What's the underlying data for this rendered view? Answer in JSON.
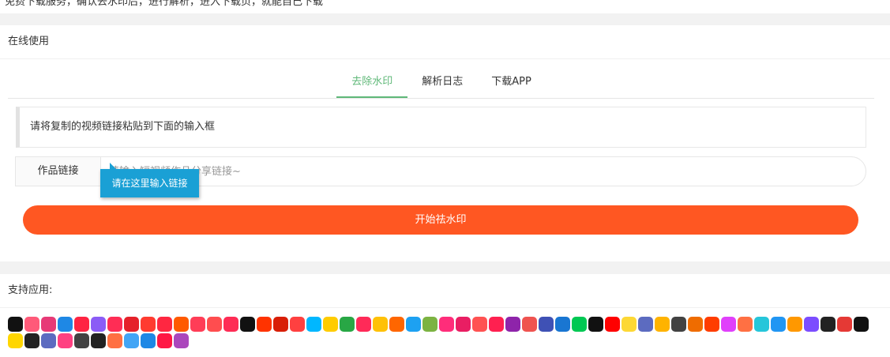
{
  "top_strip": {
    "text": "免费下载服务，确认去水印后，进行解析，进入下载页，就能自己下载"
  },
  "online": {
    "header": "在线使用",
    "tabs": [
      {
        "label": "去除水印",
        "active": true
      },
      {
        "label": "解析日志",
        "active": false
      },
      {
        "label": "下载APP",
        "active": false
      }
    ],
    "instruction": "请将复制的视频链接粘贴到下面的输入框",
    "link_label": "作品链接",
    "link_placeholder": "请输入短视频作品分享链接~",
    "link_value": "",
    "tooltip": "请在这里输入链接",
    "start_button": "开始祛水印"
  },
  "apps": {
    "header": "支持应用:",
    "icon_colors": [
      "#111111",
      "#ff5a79",
      "#e73a77",
      "#1e88e5",
      "#ff2442",
      "#8b5cf6",
      "#ff2d55",
      "#e5212a",
      "#ff3b30",
      "#ff2741",
      "#ff5a00",
      "#ff3d57",
      "#ff4d4f",
      "#fe2c55",
      "#111111",
      "#ff3300",
      "#d81e06",
      "#ff4040",
      "#00b7ff",
      "#ffcc00",
      "#28a745",
      "#ff2a58",
      "#ffc107",
      "#ff6600",
      "#1da1f2",
      "#7cb342",
      "#ff2d7a",
      "#e91e63",
      "#ff5252",
      "#ff2050",
      "#8e24aa",
      "#ef5350",
      "#3f51b5",
      "#1976d2",
      "#00c853",
      "#111111",
      "#ff0000",
      "#fdd835",
      "#5c6bc0",
      "#ffb300",
      "#424242",
      "#ef6c00",
      "#ff3d00",
      "#e040fb",
      "#ff7043",
      "#26c6da",
      "#2196f3",
      "#ff9800",
      "#7c4dff",
      "#222222",
      "#e53935",
      "#111111",
      "#ffd600",
      "#222222",
      "#5c6bc0",
      "#ff4081",
      "#424242",
      "#222222",
      "#ff7043",
      "#42a5f5",
      "#1e88e5",
      "#ff1744",
      "#ab47bc"
    ]
  }
}
